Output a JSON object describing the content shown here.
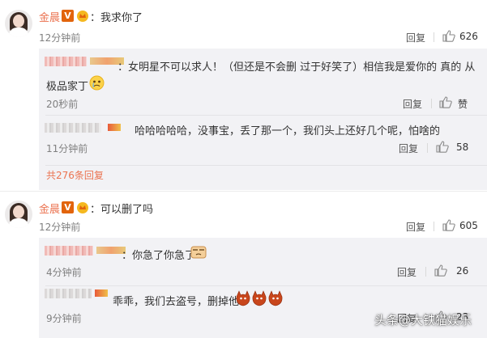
{
  "colors": {
    "username": "#eb7350",
    "vip_badge": "#e2640c",
    "reply_bg": "#f2f2f5",
    "link": "#eb7350"
  },
  "comments": [
    {
      "user": "金晨",
      "text": "：我求你了",
      "time": "12分钟前",
      "reply_label": "回复",
      "likes": "626",
      "replies": [
        {
          "text": "：女明星不可以求人！（但还是不会删 过于好笑了）相信我是爱你的 真的 从",
          "text2": "极品家丁",
          "emoji": "cry-face-icon",
          "time": "20秒前",
          "reply_label": "回复",
          "likes": "赞"
        },
        {
          "text": "哈哈哈哈哈，没事宝，丢了那一个，我们头上还好几个呢，怕啥的",
          "time": "11分钟前",
          "reply_label": "回复",
          "likes": "58"
        }
      ],
      "more": "共276条回复"
    },
    {
      "user": "金晨",
      "text": "：可以删了吗",
      "time": "12分钟前",
      "reply_label": "回复",
      "likes": "605",
      "replies": [
        {
          "text": "：你急了你急了",
          "emoji": "anxious-emoji-icon",
          "time": "4分钟前",
          "reply_label": "回复",
          "likes": "26"
        },
        {
          "text": "乖乖，我们去盗号，删掉他",
          "emoji": "devil-emoji-icon",
          "time": "9分钟前",
          "reply_label": "回复",
          "likes": "23"
        }
      ]
    }
  ],
  "watermark": "头条@大铁猫娱乐"
}
